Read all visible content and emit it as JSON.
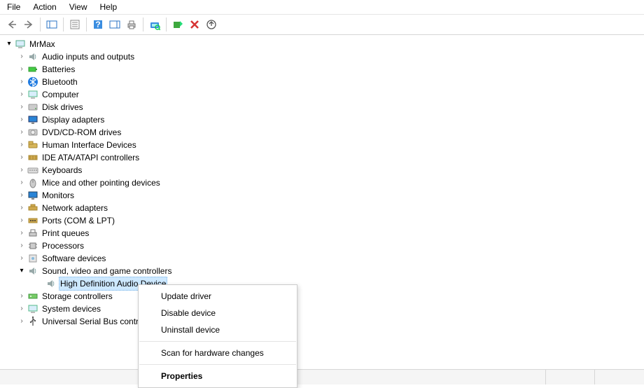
{
  "menus": {
    "file": "File",
    "action": "Action",
    "view": "View",
    "help": "Help"
  },
  "root": {
    "label": "MrMax"
  },
  "categories": [
    {
      "key": "audio",
      "label": "Audio inputs and outputs"
    },
    {
      "key": "batteries",
      "label": "Batteries"
    },
    {
      "key": "bluetooth",
      "label": "Bluetooth"
    },
    {
      "key": "computer",
      "label": "Computer"
    },
    {
      "key": "disk",
      "label": "Disk drives"
    },
    {
      "key": "display",
      "label": "Display adapters"
    },
    {
      "key": "dvd",
      "label": "DVD/CD-ROM drives"
    },
    {
      "key": "hid",
      "label": "Human Interface Devices"
    },
    {
      "key": "ide",
      "label": "IDE ATA/ATAPI controllers"
    },
    {
      "key": "keyboards",
      "label": "Keyboards"
    },
    {
      "key": "mice",
      "label": "Mice and other pointing devices"
    },
    {
      "key": "monitors",
      "label": "Monitors"
    },
    {
      "key": "network",
      "label": "Network adapters"
    },
    {
      "key": "ports",
      "label": "Ports (COM & LPT)"
    },
    {
      "key": "printq",
      "label": "Print queues"
    },
    {
      "key": "processors",
      "label": "Processors"
    },
    {
      "key": "software",
      "label": "Software devices"
    },
    {
      "key": "sound",
      "label": "Sound, video and game controllers"
    },
    {
      "key": "storage",
      "label": "Storage controllers"
    },
    {
      "key": "system",
      "label": "System devices"
    },
    {
      "key": "usb",
      "label": "Universal Serial Bus controllers"
    }
  ],
  "selected_device": {
    "label": "High Definition Audio Device"
  },
  "context_menu": {
    "update": "Update driver",
    "disable": "Disable device",
    "uninstall": "Uninstall device",
    "scan": "Scan for hardware changes",
    "properties": "Properties"
  }
}
